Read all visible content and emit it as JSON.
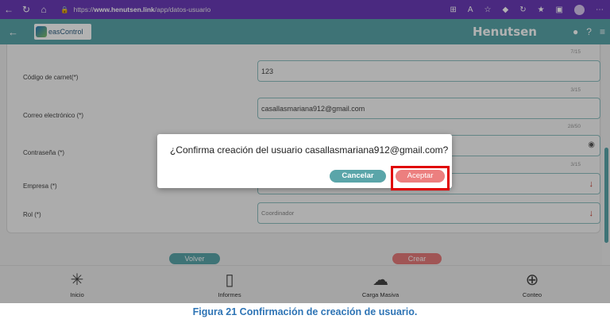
{
  "browser": {
    "url_prefix": "https://",
    "url_domain": "www.henutsen.link",
    "url_path": "/app/datos-usuario"
  },
  "header": {
    "logo_text": "easControl",
    "brand": "Henutsen"
  },
  "form": {
    "fields": [
      {
        "label": "Código de carnet(*)",
        "value": "123",
        "counter": "7/15"
      },
      {
        "label": "Correo electrónico (*)",
        "value": "casallasmariana912@gmail.com",
        "counter": "3/15"
      },
      {
        "label": "Contraseña (*)",
        "value": "",
        "counter": "28/50"
      },
      {
        "label": "Empresa (*)",
        "value": "",
        "counter": "3/15"
      },
      {
        "label": "Rol (*)",
        "value": "Coordinador",
        "counter": ""
      }
    ]
  },
  "buttons": {
    "volver": "Volver",
    "crear": "Crear"
  },
  "nav": {
    "items": [
      {
        "label": "Inicio"
      },
      {
        "label": "Informes"
      },
      {
        "label": "Carga Masiva"
      },
      {
        "label": "Conteo"
      }
    ]
  },
  "dialog": {
    "message": "¿Confirma creación del usuario casallasmariana912@gmail.com?",
    "cancel": "Cancelar",
    "accept": "Aceptar"
  },
  "caption": "Figura 21 Confirmación de creación de usuario.",
  "colors": {
    "browser_bar": "#6a3bb8",
    "teal": "#5aa5a9",
    "red_button": "#ec7f7f",
    "highlight": "#e00000",
    "caption": "#2e74b5"
  }
}
